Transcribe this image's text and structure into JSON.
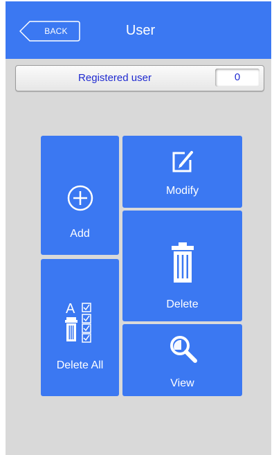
{
  "header": {
    "back_label": "BACK",
    "title": "User"
  },
  "registered": {
    "label": "Registered user",
    "count": "0"
  },
  "tiles": {
    "add": "Add",
    "modify": "Modify",
    "delete": "Delete",
    "delete_all": "Delete All",
    "view": "View"
  },
  "icons": {
    "back": "back-arrow-icon",
    "add": "plus-circle-icon",
    "modify": "edit-icon",
    "delete": "trash-icon",
    "delete_all": "delete-all-checklist-icon",
    "view": "magnifier-icon"
  },
  "colors": {
    "accent": "#3b78f2",
    "background": "#d9d9d9",
    "label_text": "#1f2ad0"
  }
}
